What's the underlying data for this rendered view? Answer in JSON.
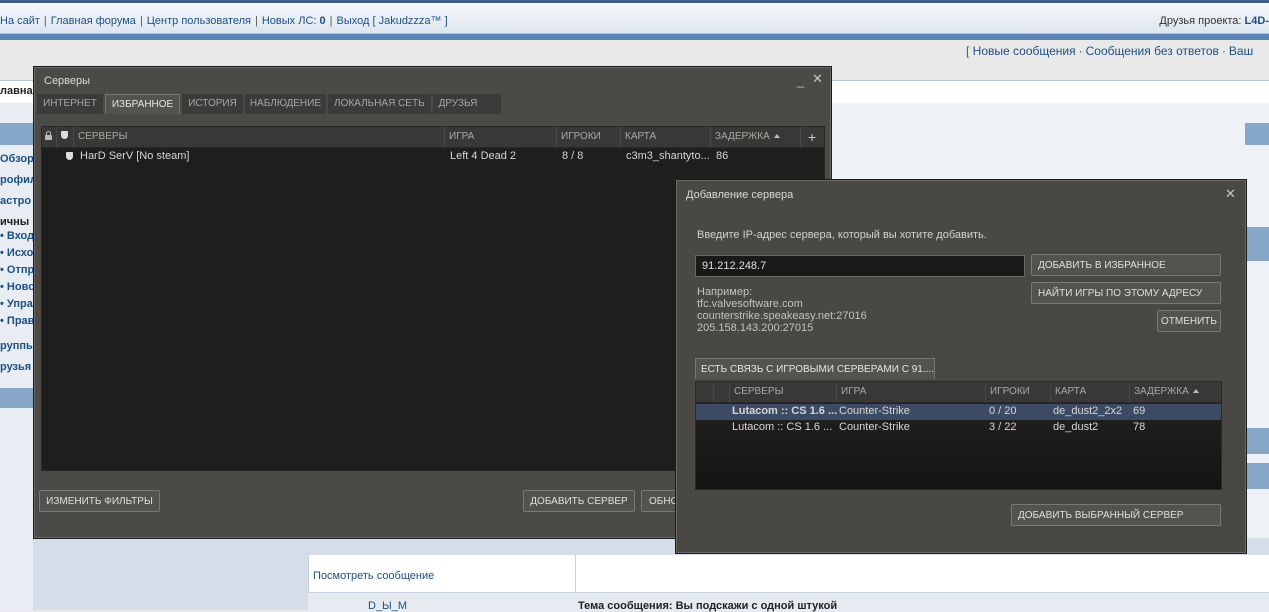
{
  "forum": {
    "top_links": [
      "На сайт",
      "Главная форума",
      "Центр пользователя",
      "Новых ЛС:",
      "0",
      "Выход [ Jakudzzza™ ]"
    ],
    "friends_label": "Друзья проекта:",
    "friends_value": "L4D-",
    "new_links": [
      "Новые сообщения",
      "Сообщения без ответов",
      "Ваш"
    ],
    "nav_label": "лавна",
    "sidebar_items": [
      "Обзор",
      "рофил",
      "астро",
      "ичны",
      "• Вход",
      "• Исхо",
      "• Отпр",
      "• Ново",
      "• Упра",
      "• Прав",
      "руппы",
      "рузья"
    ],
    "view_message": "Посмотреть сообщение",
    "post_author": "D_Ы_M",
    "post_subject": "Тема сообщения: Вы подскажи с одной штукой"
  },
  "servers_window": {
    "title": "Серверы",
    "tabs": [
      "ИНТЕРНЕТ",
      "ИЗБРАННОЕ",
      "ИСТОРИЯ",
      "НАБЛЮДЕНИЕ",
      "ЛОКАЛЬНАЯ СЕТЬ",
      "ДРУЗЬЯ"
    ],
    "active_tab": "ИЗБРАННОЕ",
    "columns": {
      "servers": "СЕРВЕРЫ",
      "game": "ИГРА",
      "players": "ИГРОКИ",
      "map": "КАРТА",
      "latency": "ЗАДЕРЖКА",
      "add": "+"
    },
    "rows": [
      {
        "name": "HarD SerV [No steam]",
        "game": "Left 4 Dead 2",
        "players": "8 / 8",
        "map": "c3m3_shantyto...",
        "latency": "86"
      }
    ],
    "buttons": {
      "filters": "ИЗМЕНИТЬ ФИЛЬТРЫ",
      "add_server": "ДОБАВИТЬ СЕРВЕР",
      "refresh": "ОБНО"
    }
  },
  "add_dialog": {
    "title": "Добавление сервера",
    "prompt": "Введите IP-адрес сервера, который вы хотите добавить.",
    "ip_value": "91.212.248.7",
    "examples_label": "Например:",
    "examples": [
      "tfc.valvesoftware.com",
      "counterstrike.speakeasy.net:27016",
      "205.158.143.200:27015"
    ],
    "btn_add_fav": "ДОБАВИТЬ В ИЗБРАННОЕ",
    "btn_find_games": "НАЙТИ ИГРЫ ПО ЭТОМУ АДРЕСУ",
    "btn_cancel": "ОТМЕНИТЬ",
    "connection_tab": "ЕСТЬ СВЯЗЬ С ИГРОВЫМИ СЕРВЕРАМИ С 91....",
    "columns": {
      "servers": "СЕРВЕРЫ",
      "game": "ИГРА",
      "players": "ИГРОКИ",
      "map": "КАРТА",
      "latency": "ЗАДЕРЖКА"
    },
    "rows": [
      {
        "name": "Lutacom :: CS 1.6 ...",
        "game": "Counter-Strike",
        "players": "0 / 20",
        "map": "de_dust2_2x2",
        "latency": "69",
        "selected": true
      },
      {
        "name": "Lutacom :: CS 1.6 ...",
        "game": "Counter-Strike",
        "players": "3 / 22",
        "map": "de_dust2",
        "latency": "78",
        "selected": false
      }
    ],
    "btn_add_selected": "ДОБАВИТЬ ВЫБРАННЫЙ СЕРВЕР"
  }
}
